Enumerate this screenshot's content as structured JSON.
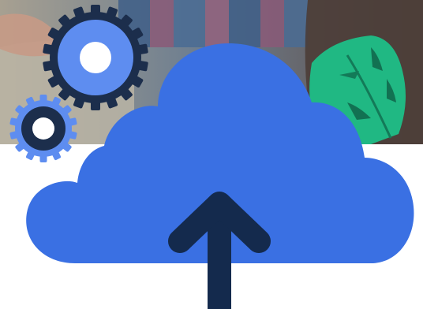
{
  "illustration": {
    "subject": "cloud-upload",
    "colors": {
      "cloud": "#3a70e3",
      "arrow": "#142a4d",
      "gear_large_ring": "#1c2e4c",
      "gear_large_fill": "#5e8df0",
      "gear_large_hub": "#ffffff",
      "gear_small_ring": "#5e8df0",
      "gear_small_fill": "#1c2e4c",
      "gear_small_hub": "#ffffff",
      "leaf": "#20b883",
      "leaf_vein": "#137a58",
      "photo_left": "#a7a091",
      "photo_middle": "#6f7f90",
      "photo_right": "#5d4e48",
      "sweater_stripe_a": "#3f5f88",
      "sweater_stripe_b": "#8a5a78",
      "background": "#ffffff"
    }
  }
}
